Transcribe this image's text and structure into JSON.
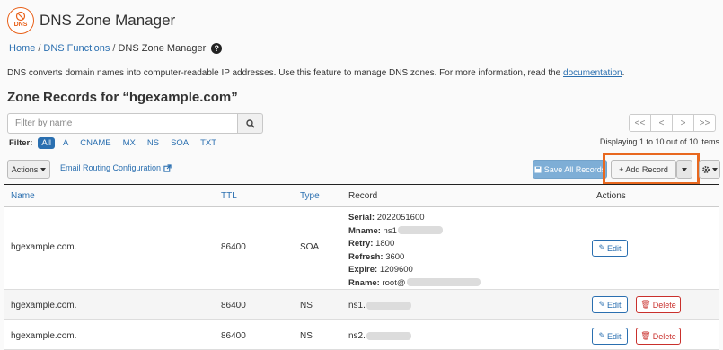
{
  "app": {
    "title": "DNS Zone Manager",
    "logo_text": "DNS"
  },
  "breadcrumb": {
    "items": [
      "Home",
      "DNS Functions",
      "DNS Zone Manager"
    ],
    "separator": "/"
  },
  "help_glyph": "?",
  "description": {
    "text": "DNS converts domain names into computer-readable IP addresses. Use this feature to manage DNS zones. For more information, read the",
    "link": "documentation",
    "end": "."
  },
  "section_title": "Zone Records for “hgexample.com”",
  "search": {
    "placeholder": "Filter by name",
    "value": ""
  },
  "pager": {
    "first": "<<",
    "prev": "<",
    "next": ">",
    "last": ">>"
  },
  "filter": {
    "label": "Filter:",
    "items": [
      "All",
      "A",
      "CNAME",
      "MX",
      "NS",
      "SOA",
      "TXT"
    ],
    "active": "All"
  },
  "display_info": "Displaying 1 to 10 out of 10 items",
  "toolbar": {
    "actions_label": "Actions",
    "email_routing": "Email Routing Configuration",
    "save_all": "Save All Records",
    "add_record": "+ Add Record"
  },
  "table": {
    "headers": {
      "name": "Name",
      "ttl": "TTL",
      "type": "Type",
      "record": "Record",
      "actions": "Actions"
    },
    "rows": [
      {
        "name": "hgexample.com.",
        "ttl": "86400",
        "type": "SOA",
        "soa": {
          "serial_label": "Serial:",
          "serial": "2022051600",
          "mname_label": "Mname:",
          "mname": "ns1",
          "retry_label": "Retry:",
          "retry": "1800",
          "refresh_label": "Refresh:",
          "refresh": "3600",
          "expire_label": "Expire:",
          "expire": "1209600",
          "rname_label": "Rname:",
          "rname": "root@"
        }
      },
      {
        "name": "hgexample.com.",
        "ttl": "86400",
        "type": "NS",
        "record": "ns1."
      },
      {
        "name": "hgexample.com.",
        "ttl": "86400",
        "type": "NS",
        "record": "ns2."
      }
    ],
    "edit_label": "Edit",
    "delete_label": "Delete"
  },
  "colors": {
    "link": "#2a6fb0",
    "highlight": "#e8681f",
    "danger": "#c9302c",
    "save_button": "#7eaed6"
  }
}
